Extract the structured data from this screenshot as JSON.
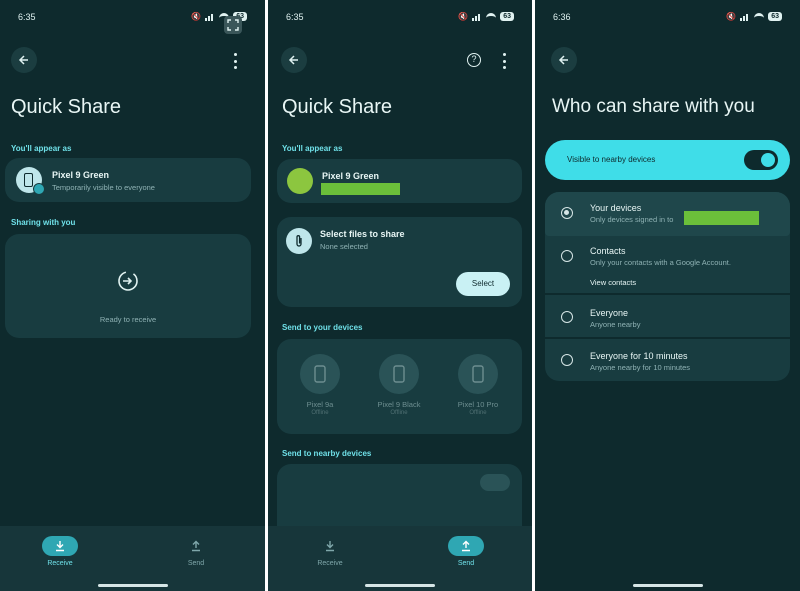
{
  "screen1": {
    "status": {
      "time": "6:35",
      "battery": "63"
    },
    "title": "Quick Share",
    "appear_label": "You'll appear as",
    "device_name": "Pixel 9 Green",
    "visibility": "Temporarily visible to everyone",
    "sharing_label": "Sharing with you",
    "ready": "Ready to receive",
    "nav": {
      "receive": "Receive",
      "send": "Send"
    }
  },
  "screen2": {
    "status": {
      "time": "6:35",
      "battery": "63"
    },
    "title": "Quick Share",
    "appear_label": "You'll appear as",
    "device_name": "Pixel 9 Green",
    "select_title": "Select files to share",
    "select_sub": "None selected",
    "select_button": "Select",
    "your_devices_label": "Send to your devices",
    "devices": [
      {
        "name": "Pixel 9a",
        "sub": "Offline"
      },
      {
        "name": "Pixel 9 Black",
        "sub": "Offline"
      },
      {
        "name": "Pixel 10 Pro",
        "sub": "Offline"
      }
    ],
    "nearby_label": "Send to nearby devices",
    "nav": {
      "receive": "Receive",
      "send": "Send"
    }
  },
  "screen3": {
    "status": {
      "time": "6:36",
      "battery": "63"
    },
    "title": "Who can share with you",
    "toggle_label": "Visible to nearby devices",
    "options": [
      {
        "title": "Your devices",
        "sub": "Only devices signed in to"
      },
      {
        "title": "Contacts",
        "sub": "Only your contacts with a Google Account.",
        "link": "View contacts"
      },
      {
        "title": "Everyone",
        "sub": "Anyone nearby"
      },
      {
        "title": "Everyone for 10 minutes",
        "sub": "Anyone nearby for 10 minutes"
      }
    ]
  },
  "colors": {
    "background": "#0e2a2d",
    "card": "#183c40",
    "accent": "#6fe0e8",
    "toggle_bg": "#3fdde8",
    "redaction": "#6bbf3a"
  }
}
